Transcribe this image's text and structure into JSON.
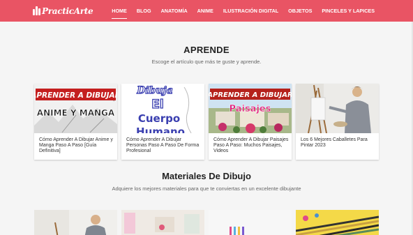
{
  "header": {
    "brand": "PracticArte",
    "nav": [
      "HOME",
      "BLOG",
      "ANATOMÍA",
      "ANIME",
      "ILUSTRACIÓN DIGITAL",
      "OBJETOS",
      "PINCELES Y LAPICES"
    ]
  },
  "learn": {
    "title": "APRENDE",
    "subtitle": "Escoge el artículo que más te guste y aprende."
  },
  "articles": [
    {
      "title": "Cómo Aprender A Dibujar Anime y Manga Paso A Paso [Guía Definitiva]",
      "thumb_text_1": "APRENDER A DIBUJAR",
      "thumb_text_2": "ANIME Y MANGA"
    },
    {
      "title": "Cómo Aprender A Dibujar Personas Paso A Paso De Forma Profesional",
      "thumb_text_1": "Dibuja",
      "thumb_text_2": "El",
      "thumb_text_3": "Cuerpo",
      "thumb_text_4": "Humano"
    },
    {
      "title": "Cómo Aprender A Dibujar Paisajes Paso A Paso: Muchos Paisajes, Videos",
      "thumb_text_1": "APRENDER A DIBUJAR",
      "thumb_text_2": "Paisajes"
    },
    {
      "title": "Los 6 Mejores Caballetes Para Pintar 2023"
    }
  ],
  "materials": {
    "title": "Materiales De Dibujo",
    "subtitle": "Adquiere los mejores materiales para que te conviertas en un excelente dibujante"
  },
  "colors": {
    "brand": "#e95464",
    "text": "#333333"
  }
}
